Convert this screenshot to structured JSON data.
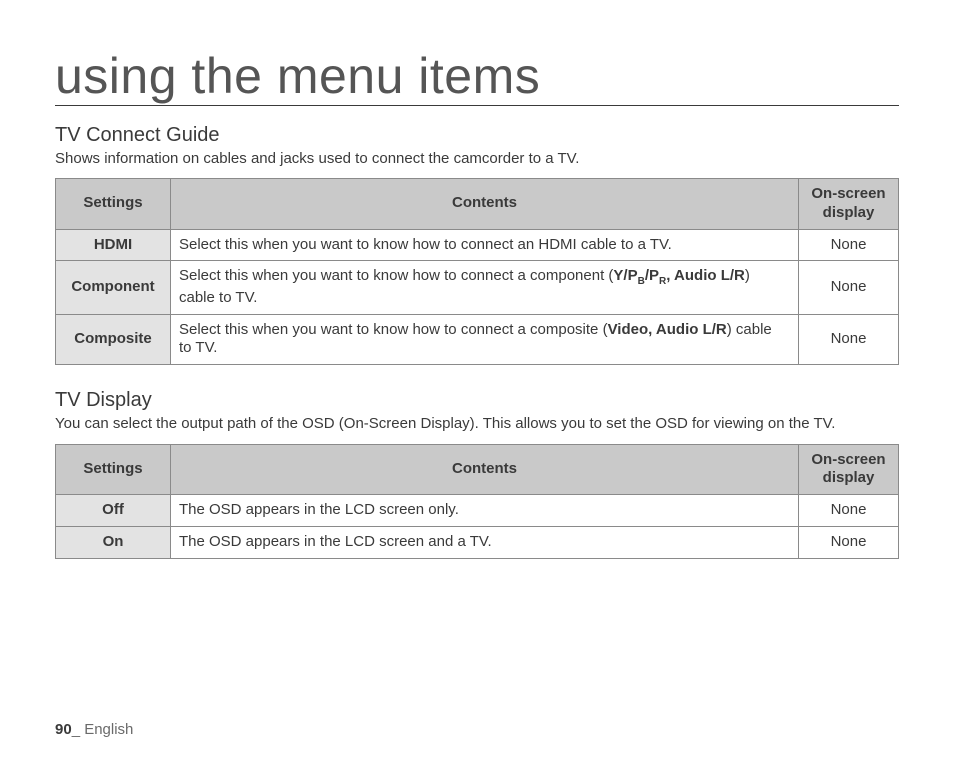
{
  "pageTitle": "using the menu items",
  "sections": [
    {
      "title": "TV Connect Guide",
      "desc": "Shows information on cables and jacks used to connect the camcorder to a TV.",
      "headers": {
        "settings": "Settings",
        "contents": "Contents",
        "osd": "On-screen display"
      },
      "rows": [
        {
          "setting": "HDMI",
          "contentHtml": "Select this when you want to know how to connect an HDMI cable to a TV.",
          "osd": "None"
        },
        {
          "setting": "Component",
          "contentHtml": "Select this when you want to know how to connect a component (<span class=\"bold\">Y/P<span class=\"sub\">B</span>/P<span class=\"sub\">R</span>, Audio L/R</span>) cable to TV.",
          "osd": "None"
        },
        {
          "setting": "Composite",
          "contentHtml": "Select this when you want to know how to connect a composite (<span class=\"bold\">Video, Audio L/R</span>) cable to TV.",
          "osd": "None"
        }
      ]
    },
    {
      "title": "TV Display",
      "desc": "You can select the output path of the OSD (On-Screen Display). This allows you to set the OSD for viewing on the TV.",
      "headers": {
        "settings": "Settings",
        "contents": "Contents",
        "osd": "On-screen display"
      },
      "rows": [
        {
          "setting": "Off",
          "contentHtml": "The OSD appears in the LCD screen only.",
          "osd": "None"
        },
        {
          "setting": "On",
          "contentHtml": "The OSD appears in the LCD screen and a TV.",
          "osd": "None"
        }
      ]
    }
  ],
  "footer": {
    "pageNum": "90",
    "sep": "_ ",
    "lang": "English"
  }
}
